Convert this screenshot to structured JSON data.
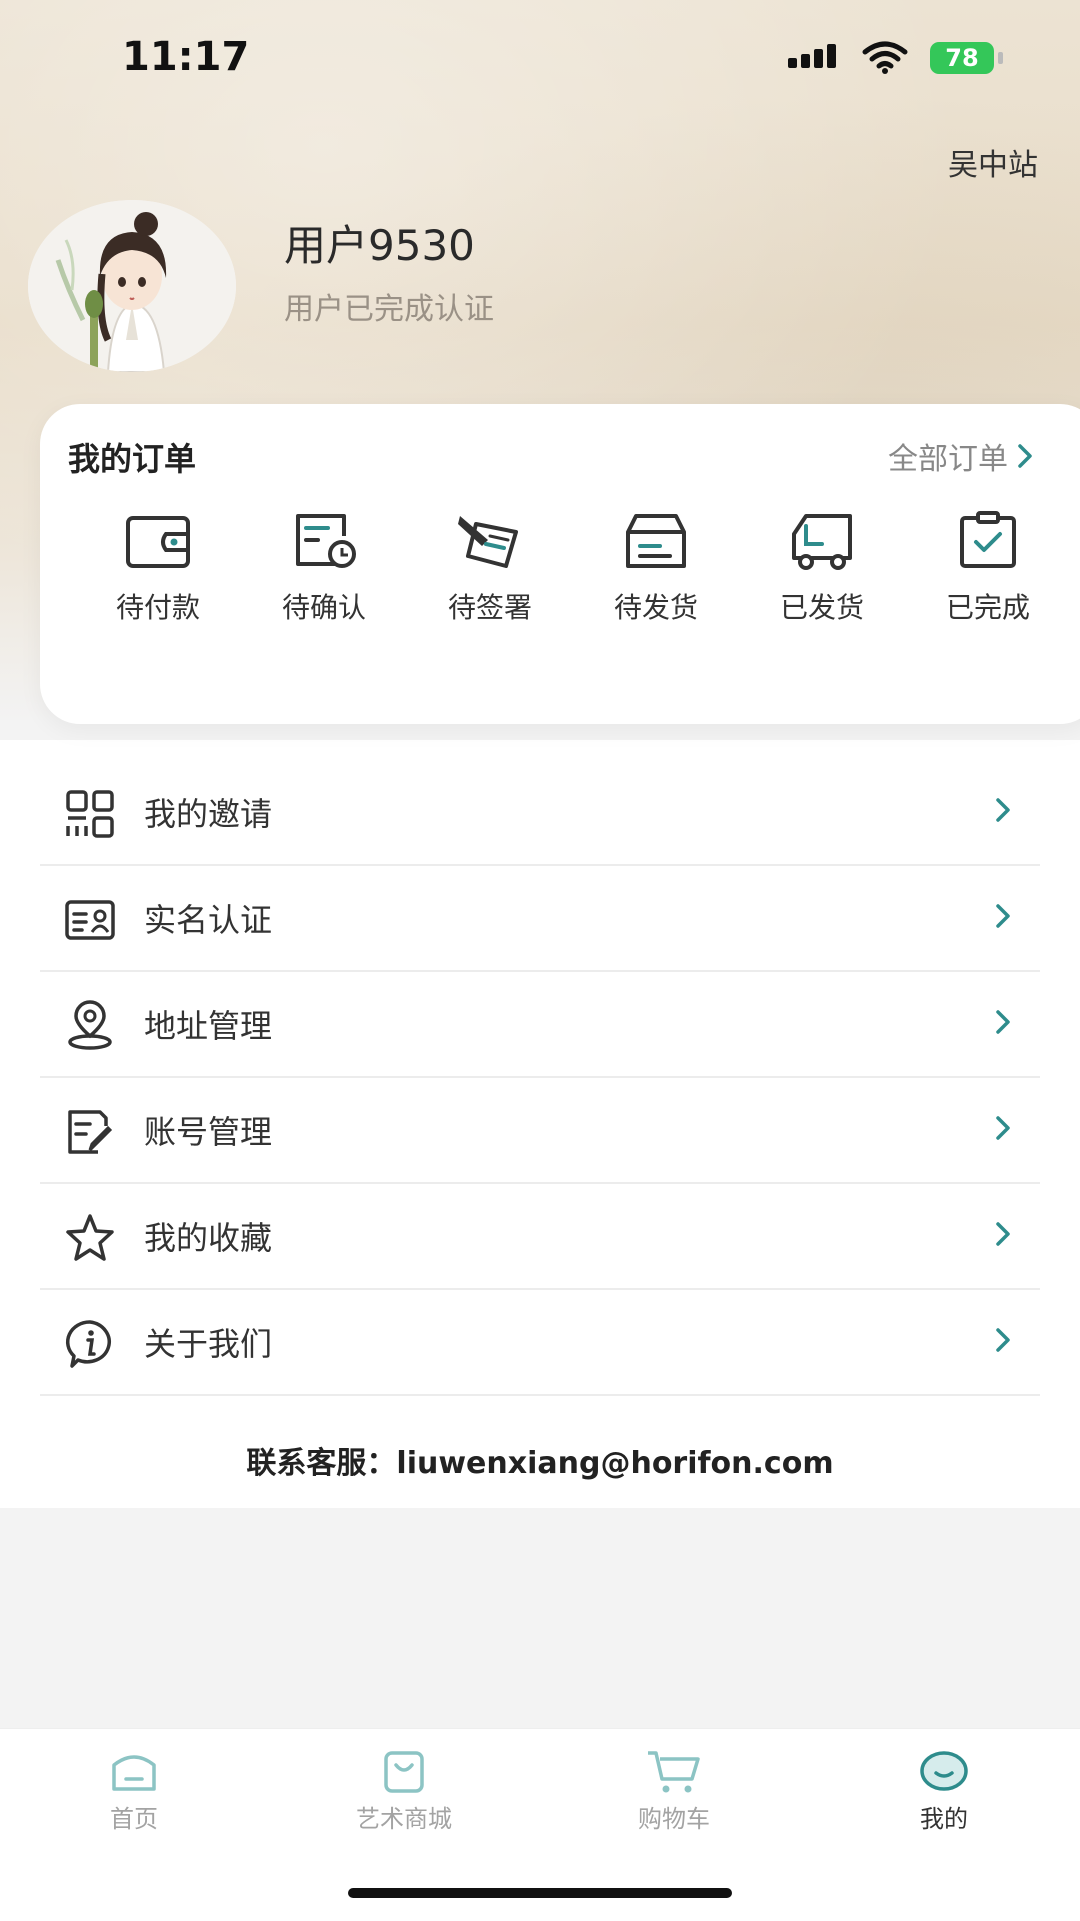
{
  "status_bar": {
    "time": "11:17",
    "battery": "78"
  },
  "header": {
    "station": "吴中站",
    "username": "用户9530",
    "verify_status": "用户已完成认证"
  },
  "orders": {
    "title": "我的订单",
    "all_label": "全部订单",
    "items": [
      {
        "label": "待付款",
        "icon": "wallet-icon"
      },
      {
        "label": "待确认",
        "icon": "pending-clock-icon"
      },
      {
        "label": "待签署",
        "icon": "signature-pen-icon"
      },
      {
        "label": "待发货",
        "icon": "box-icon"
      },
      {
        "label": "已发货",
        "icon": "truck-icon"
      },
      {
        "label": "已完成",
        "icon": "check-clipboard-icon"
      }
    ]
  },
  "menu": [
    {
      "label": "我的邀请",
      "icon": "qr-grid-icon"
    },
    {
      "label": "实名认证",
      "icon": "id-card-icon"
    },
    {
      "label": "地址管理",
      "icon": "location-pin-icon"
    },
    {
      "label": "账号管理",
      "icon": "edit-document-icon"
    },
    {
      "label": "我的收藏",
      "icon": "star-icon"
    },
    {
      "label": "关于我们",
      "icon": "info-icon"
    }
  ],
  "contact": "联系客服：liuwenxiang@horifon.com",
  "tabs": [
    {
      "label": "首页",
      "icon": "home-icon",
      "active": false
    },
    {
      "label": "艺术商城",
      "icon": "shopping-bag-icon",
      "active": false
    },
    {
      "label": "购物车",
      "icon": "cart-icon",
      "active": false
    },
    {
      "label": "我的",
      "icon": "profile-face-icon",
      "active": true
    }
  ],
  "colors": {
    "accent": "#2e8c8c",
    "icon_dark": "#333333"
  }
}
